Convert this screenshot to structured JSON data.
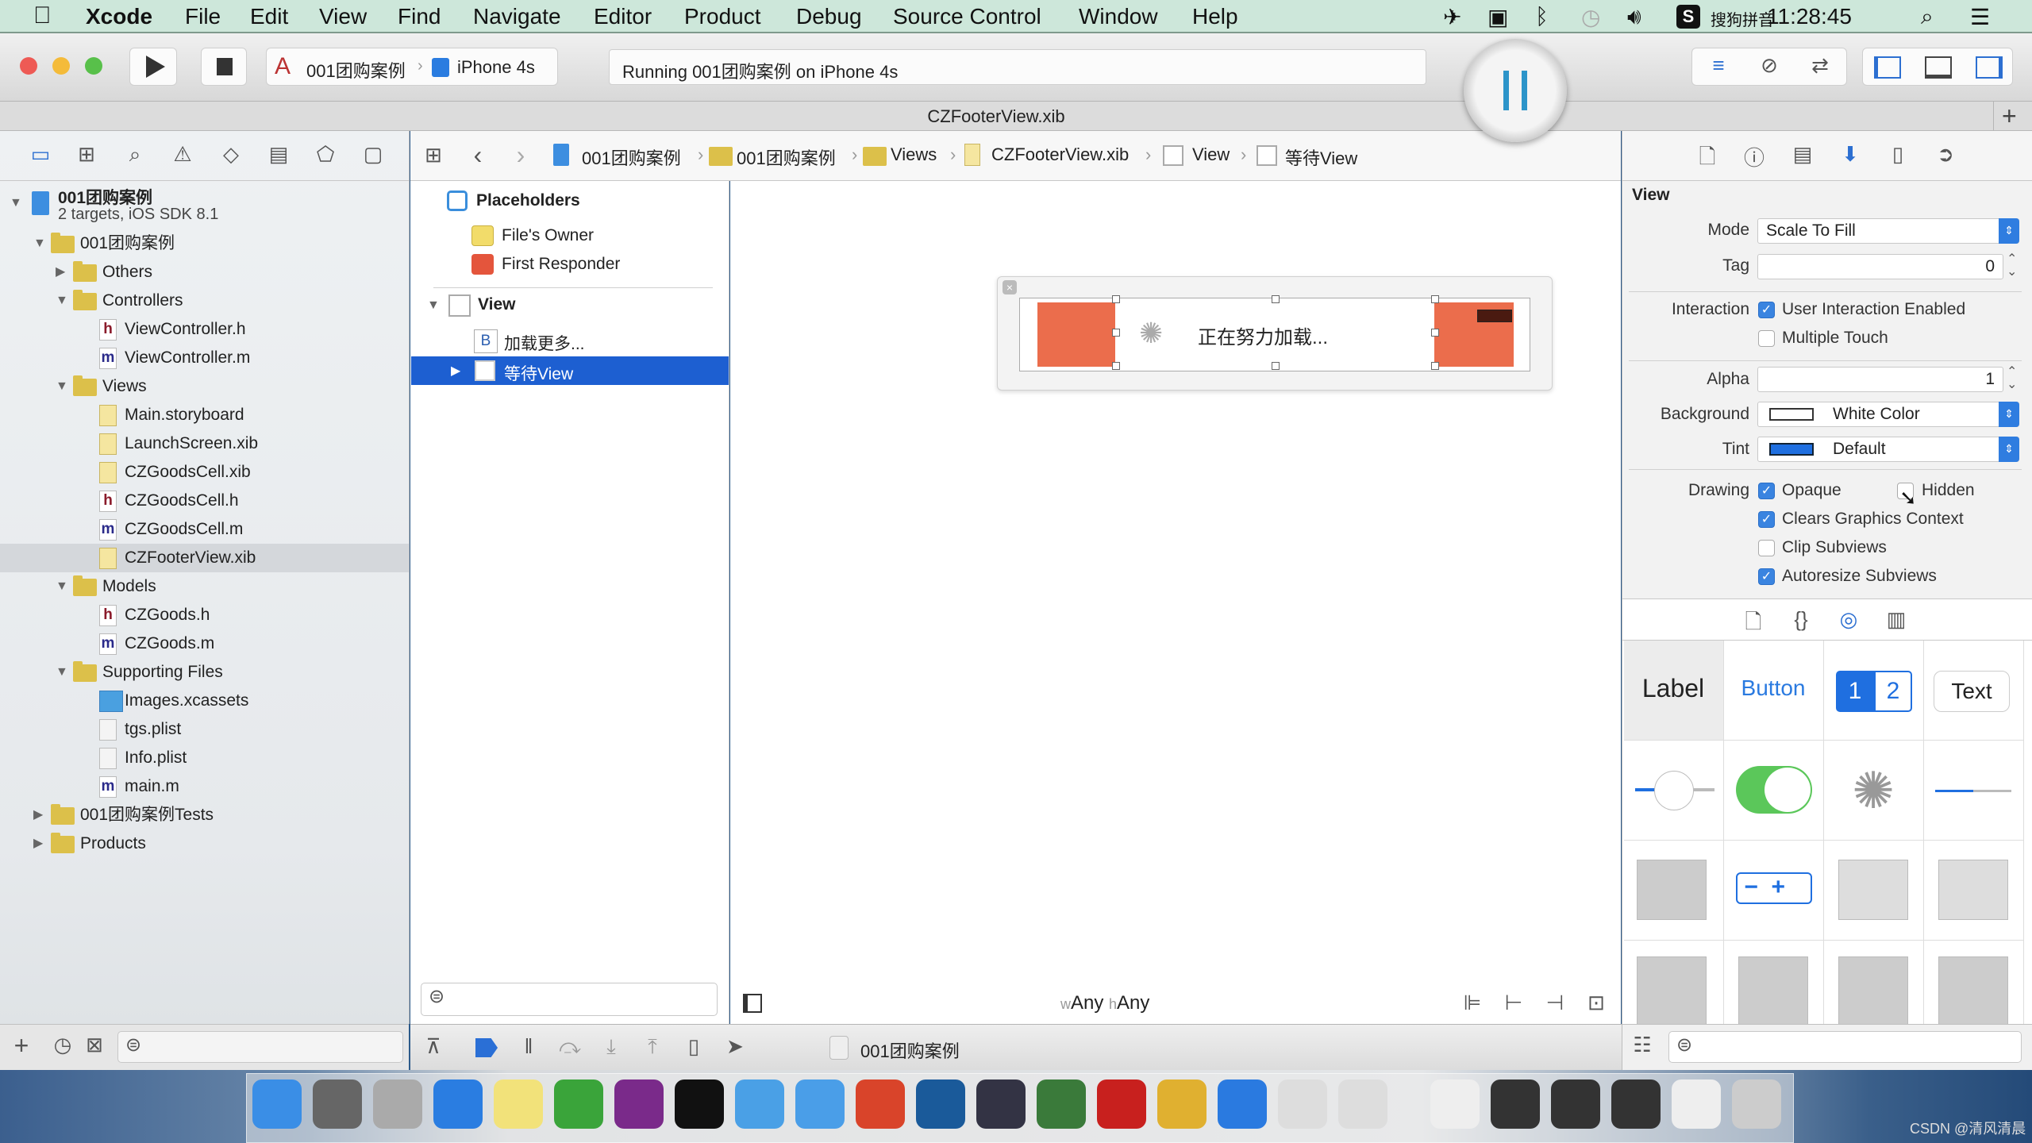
{
  "menubar": {
    "apple_icon": "apple-icon",
    "items": [
      "Xcode",
      "File",
      "Edit",
      "View",
      "Find",
      "Navigate",
      "Editor",
      "Product",
      "Debug",
      "Source Control",
      "Window",
      "Help"
    ],
    "status_icons": [
      "airplane-icon",
      "screen-record-icon",
      "bluetooth-icon",
      "time-machine-icon",
      "volume-icon",
      "sogou-icon"
    ],
    "input_method": "搜狗拼音",
    "time": "11:28:45"
  },
  "toolbar": {
    "scheme": "001团购案例",
    "device": "iPhone 4s",
    "activity": "Running 001团购案例 on iPhone 4s",
    "pause_icon": "pause-icon"
  },
  "tab": {
    "title": "CZFooterView.xib",
    "add": "+"
  },
  "jumpbar": {
    "crumbs": [
      "001团购案例",
      "001团购案例",
      "Views",
      "CZFooterView.xib",
      "View",
      "等待View"
    ]
  },
  "navigator": {
    "project": {
      "name": "001团购案例",
      "subtitle": "2 targets, iOS SDK 8.1"
    },
    "rows": [
      {
        "label": "001团购案例",
        "level": 1,
        "kind": "folder",
        "disclosure": "open"
      },
      {
        "label": "Others",
        "level": 2,
        "kind": "folder",
        "disclosure": "closed"
      },
      {
        "label": "Controllers",
        "level": 2,
        "kind": "folder",
        "disclosure": "open"
      },
      {
        "label": "ViewController.h",
        "level": 3,
        "kind": "h"
      },
      {
        "label": "ViewController.m",
        "level": 3,
        "kind": "m"
      },
      {
        "label": "Views",
        "level": 2,
        "kind": "folder",
        "disclosure": "open"
      },
      {
        "label": "Main.storyboard",
        "level": 3,
        "kind": "xib"
      },
      {
        "label": "LaunchScreen.xib",
        "level": 3,
        "kind": "xib"
      },
      {
        "label": "CZGoodsCell.xib",
        "level": 3,
        "kind": "xib"
      },
      {
        "label": "CZGoodsCell.h",
        "level": 3,
        "kind": "h"
      },
      {
        "label": "CZGoodsCell.m",
        "level": 3,
        "kind": "m"
      },
      {
        "label": "CZFooterView.xib",
        "level": 3,
        "kind": "xib",
        "selected": true
      },
      {
        "label": "Models",
        "level": 2,
        "kind": "folder",
        "disclosure": "open"
      },
      {
        "label": "CZGoods.h",
        "level": 3,
        "kind": "h"
      },
      {
        "label": "CZGoods.m",
        "level": 3,
        "kind": "m"
      },
      {
        "label": "Supporting Files",
        "level": 2,
        "kind": "folder",
        "disclosure": "open"
      },
      {
        "label": "Images.xcassets",
        "level": 3,
        "kind": "assets"
      },
      {
        "label": "tgs.plist",
        "level": 3,
        "kind": "plist"
      },
      {
        "label": "Info.plist",
        "level": 3,
        "kind": "plist"
      },
      {
        "label": "main.m",
        "level": 3,
        "kind": "m"
      },
      {
        "label": "001团购案例Tests",
        "level": 1,
        "kind": "folder",
        "disclosure": "closed"
      },
      {
        "label": "Products",
        "level": 1,
        "kind": "folder",
        "disclosure": "closed"
      }
    ]
  },
  "outline": {
    "placeholders": "Placeholders",
    "files_owner": "File's Owner",
    "first_responder": "First Responder",
    "view": "View",
    "button_item": "加载更多...",
    "button_badge": "B",
    "selected_item": "等待View"
  },
  "canvas": {
    "loading_text": "正在努力加载...",
    "size_class_w": "w",
    "size_class_w_value": "Any",
    "size_class_h": "h",
    "size_class_h_value": "Any",
    "accent_orange": "#eb6d4c"
  },
  "debugbar": {
    "target": "001团购案例"
  },
  "inspector": {
    "section": "View",
    "mode_label": "Mode",
    "mode_value": "Scale To Fill",
    "tag_label": "Tag",
    "tag_value": "0",
    "interaction_label": "Interaction",
    "user_interaction": {
      "label": "User Interaction Enabled",
      "checked": true
    },
    "multiple_touch": {
      "label": "Multiple Touch",
      "checked": false
    },
    "alpha_label": "Alpha",
    "alpha_value": "1",
    "background_label": "Background",
    "background_value": "White Color",
    "background_swatch": "#ffffff",
    "tint_label": "Tint",
    "tint_value": "Default",
    "tint_swatch": "#1f6fe0",
    "drawing_label": "Drawing",
    "opaque": {
      "label": "Opaque",
      "checked": true
    },
    "hidden": {
      "label": "Hidden",
      "checked": false
    },
    "clears_graphics": {
      "label": "Clears Graphics Context",
      "checked": true
    },
    "clip_subviews": {
      "label": "Clip Subviews",
      "checked": false
    },
    "autoresize": {
      "label": "Autoresize Subviews",
      "checked": true
    }
  },
  "library": {
    "label": "Label",
    "button": "Button",
    "seg1": "1",
    "seg2": "2",
    "text": "Text"
  },
  "dock": {
    "icons": [
      "finder-icon",
      "system-preferences-icon",
      "launchpad-icon",
      "safari-icon",
      "notes-icon",
      "excel-icon",
      "onenote-icon",
      "terminal-icon",
      "xcode-icon",
      "folder-icon",
      "powerpoint-icon",
      "scissors-app-icon",
      "movie-app-icon",
      "app-icon",
      "filezilla-icon",
      "pencil-app-icon",
      "word-icon",
      "instruments-icon",
      "instruments-icon",
      "preview-icon",
      "screen-sharing-icon",
      "screen-sharing-icon",
      "screen-sharing-icon",
      "downloads-icon",
      "trash-icon"
    ],
    "colors": [
      "#3a8ee6",
      "#666",
      "#aaa",
      "#2a7de1",
      "#f2e27a",
      "#3aa43a",
      "#7a2a8a",
      "#111",
      "#4aa0e6",
      "#4a9ee8",
      "#d9442a",
      "#1a5a9a",
      "#334",
      "#3a7a3a",
      "#c8201e",
      "#e0b030",
      "#2a7ae0",
      "#ddd",
      "#ddd",
      "#eee",
      "#333",
      "#333",
      "#333",
      "#eee",
      "#ccc"
    ],
    "watermark": "CSDN @清风清晨"
  }
}
